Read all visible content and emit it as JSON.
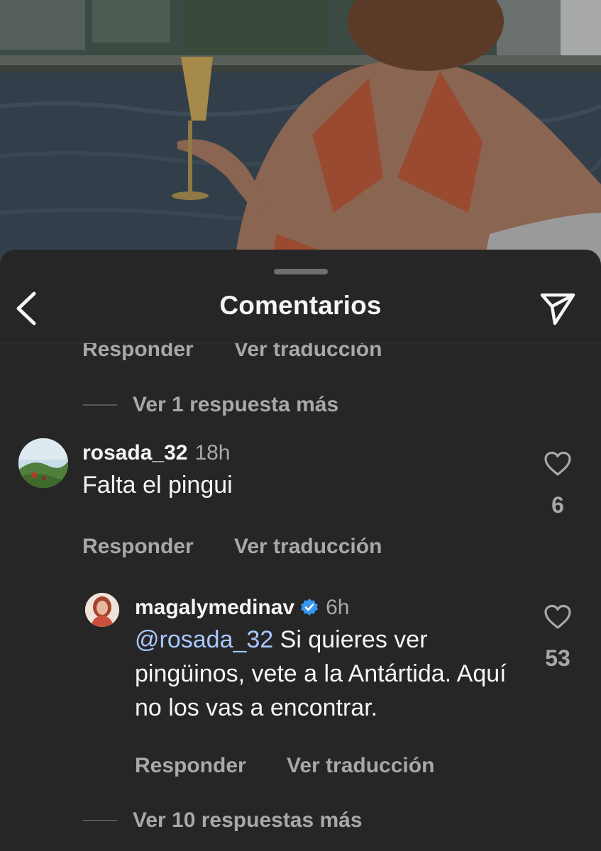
{
  "header": {
    "title": "Comentarios"
  },
  "partial_top_actions": {
    "reply_label": "Responder",
    "translate_label": "Ver traducción"
  },
  "top_more_replies": "Ver 1 respuesta más",
  "comments": [
    {
      "username": "rosada_32",
      "time": "18h",
      "text": "Falta el pingui",
      "likes": "6",
      "reply_label": "Responder",
      "translate_label": "Ver traducción",
      "avatar_icon": "landscape-avatar"
    },
    {
      "username": "magalymedinav",
      "verified": true,
      "time": "6h",
      "mention": "@rosada_32",
      "text": " Si quieres ver pingüinos, vete a la Antártida. Aquí no los vas a encontrar.",
      "likes": "53",
      "reply_label": "Responder",
      "translate_label": "Ver traducción",
      "avatar_icon": "portrait-avatar"
    }
  ],
  "bottom_more_replies": "Ver 10 respuestas más",
  "icons": {
    "back": "chevron-left-icon",
    "send": "paper-plane-icon",
    "like": "heart-outline-icon",
    "verified": "verified-badge-icon"
  },
  "colors": {
    "sheet_background": "#262626",
    "primary_text": "#f5f5f5",
    "secondary_text": "#a8a8a8",
    "mention": "#a9c7ff",
    "verified": "#3897f0"
  }
}
